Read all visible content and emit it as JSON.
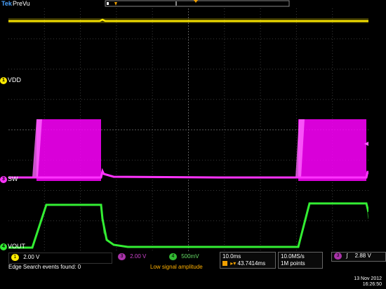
{
  "header": {
    "brand": "Tek",
    "mode": "PreVu"
  },
  "channels": [
    {
      "id": "1",
      "label": "VDD",
      "color": "#ffea00"
    },
    {
      "id": "3",
      "label": "SW",
      "color": "#ff33ff"
    },
    {
      "id": "4",
      "label": "VOUT",
      "color": "#33ee33"
    }
  ],
  "readouts": {
    "ch1_scale": "2.00 V",
    "ch3_scale": "2.00 V",
    "ch4_scale": "500mV",
    "timebase": "10.0ms",
    "delay": "43.7414ms",
    "sample_rate": "10.0MS/s",
    "record_length": "1M points",
    "trigger_level": "2.88 V",
    "trigger_channel": "3"
  },
  "status": {
    "message": "Edge Search events found: 0",
    "warning": "Low signal amplitude"
  },
  "datetime": {
    "date": "13 Nov 2012",
    "time": "16:26:50"
  }
}
